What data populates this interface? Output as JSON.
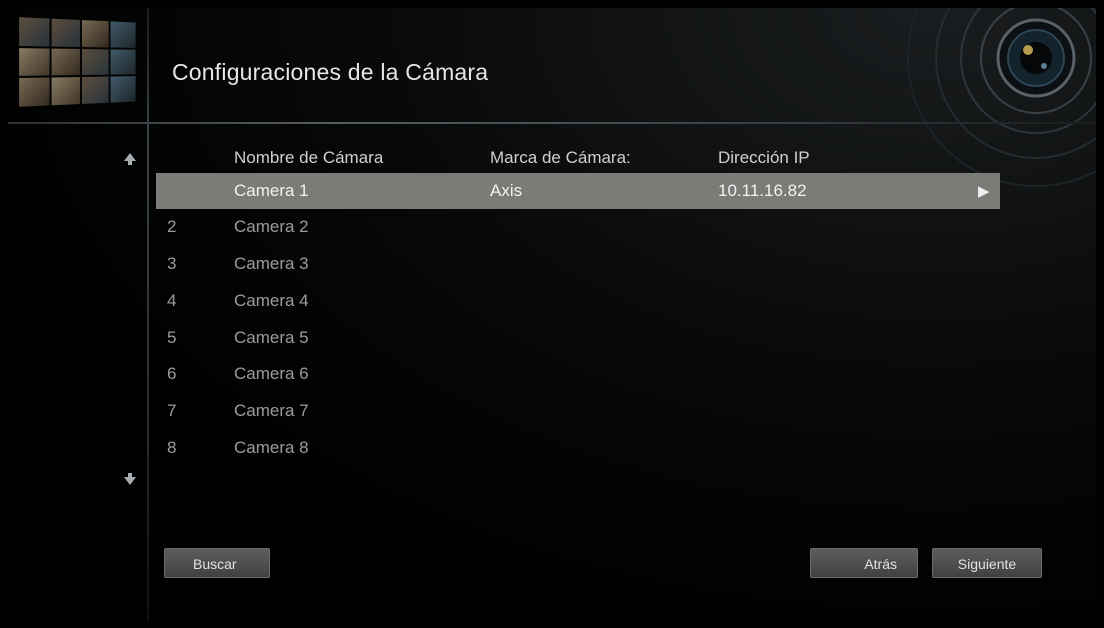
{
  "header": {
    "title": "Configuraciones de la Cámara"
  },
  "columns": {
    "name": "Nombre de Cámara",
    "brand": "Marca de Cámara:",
    "ip": "Dirección IP"
  },
  "cameras": [
    {
      "num": "",
      "name": "Camera 1",
      "brand": "Axis",
      "ip": "10.11.16.82",
      "selected": true
    },
    {
      "num": "2",
      "name": "Camera 2",
      "brand": "",
      "ip": ""
    },
    {
      "num": "3",
      "name": "Camera 3",
      "brand": "",
      "ip": ""
    },
    {
      "num": "4",
      "name": "Camera 4",
      "brand": "",
      "ip": ""
    },
    {
      "num": "5",
      "name": "Camera 5",
      "brand": "",
      "ip": ""
    },
    {
      "num": "6",
      "name": "Camera 6",
      "brand": "",
      "ip": ""
    },
    {
      "num": "7",
      "name": "Camera 7",
      "brand": "",
      "ip": ""
    },
    {
      "num": "8",
      "name": "Camera 8",
      "brand": "",
      "ip": ""
    }
  ],
  "icons": {
    "scroll_up": "up-arrow-icon",
    "scroll_down": "down-arrow-icon",
    "row_action": "play-arrow-icon",
    "lens": "camera-lens-icon",
    "thumbnail": "camera-grid-thumbnail"
  },
  "buttons": {
    "search": "Buscar",
    "back": "Atrás",
    "next": "Siguiente"
  },
  "colors": {
    "selected_row": "#7a7c78",
    "background": "#000000",
    "button": "#4d4f51"
  }
}
